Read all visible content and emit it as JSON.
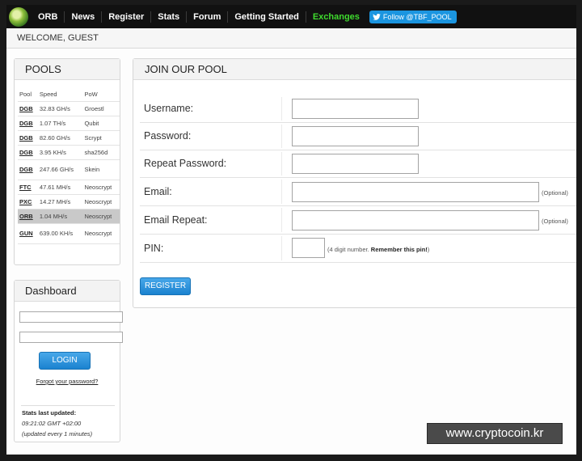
{
  "nav": {
    "items": [
      "ORB",
      "News",
      "Register",
      "Stats",
      "Forum",
      "Getting Started",
      "Exchanges"
    ],
    "twitter_label": "Follow @TBF_POOL"
  },
  "welcome": "WELCOME, GUEST",
  "pools": {
    "title": "POOLS",
    "headers": [
      "Pool",
      "Speed",
      "PoW"
    ],
    "rows": [
      {
        "pool": "DGB",
        "speed": "32.83 GH/s",
        "pow": "Groestl"
      },
      {
        "pool": "DGB",
        "speed": "1.07 TH/s",
        "pow": "Qubit"
      },
      {
        "pool": "DGB",
        "speed": "82.60 GH/s",
        "pow": "Scrypt"
      },
      {
        "pool": "DGB",
        "speed": "3.95 KH/s",
        "pow": "sha256d"
      },
      {
        "pool": "DGB",
        "speed": "247.66 GH/s",
        "pow": "Skein"
      },
      {
        "pool": "FTC",
        "speed": "47.61 MH/s",
        "pow": "Neoscrypt"
      },
      {
        "pool": "PXC",
        "speed": "14.27 MH/s",
        "pow": "Neoscrypt"
      },
      {
        "pool": "ORB",
        "speed": "1.04 MH/s",
        "pow": "Neoscrypt"
      },
      {
        "pool": "GUN",
        "speed": "639.00 KH/s",
        "pow": "Neoscrypt"
      }
    ]
  },
  "dashboard": {
    "title": "Dashboard",
    "login_label": "LOGIN",
    "forgot_label": "Forgot your password?",
    "stats_title": "Stats last updated:",
    "stats_time": "09:21:02 GMT +02:00",
    "stats_note": "(updated every 1 minutes)"
  },
  "join": {
    "title": "JOIN OUR POOL",
    "fields": {
      "username": "Username:",
      "password": "Password:",
      "repeat_password": "Repeat Password:",
      "email": "Email:",
      "email_repeat": "Email Repeat:",
      "pin": "PIN:"
    },
    "optional_note": "(Optional)",
    "pin_note_prefix": "(4 digit number. ",
    "pin_note_bold": "Remember this pin!",
    "pin_note_suffix": ")",
    "register_label": "REGISTER"
  },
  "watermark": "www.cryptocoin.kr",
  "colors": {
    "accent": "#1b82cf",
    "exchanges": "#3fdb2e",
    "navbar": "#111111"
  }
}
